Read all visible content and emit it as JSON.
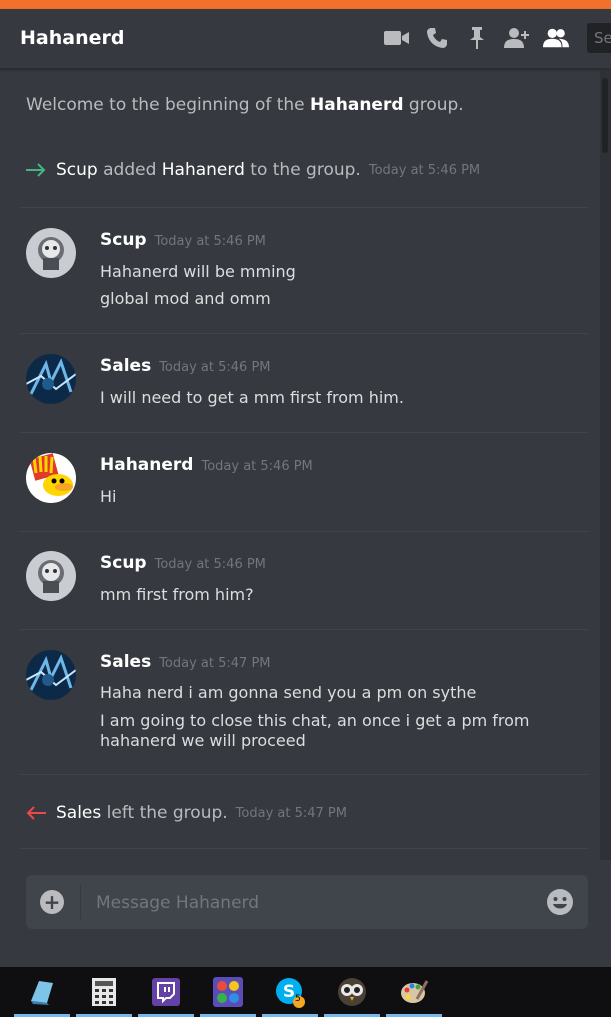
{
  "colors": {
    "accent_orange": "#f36f2c",
    "join_arrow": "#43b581",
    "leave_arrow": "#f04747",
    "bg": "#36393f"
  },
  "header": {
    "title": "Hahanerd",
    "icons": [
      "video-call-icon",
      "voice-call-icon",
      "pin-icon",
      "add-member-icon",
      "members-icon"
    ],
    "search_placeholder": "Search"
  },
  "messages": {
    "welcome_prefix": "Welcome to the beginning of the ",
    "welcome_group": "Hahanerd",
    "welcome_suffix": " group.",
    "system_join": {
      "actor": "Scup",
      "text_mid": " added ",
      "target": "Hahanerd",
      "text_end": " to the group.",
      "timestamp": "Today at 5:46 PM"
    },
    "system_leave": {
      "actor": "Sales",
      "text_end": " left the group.",
      "timestamp": "Today at 5:47 PM"
    },
    "items": [
      {
        "author": "Scup",
        "timestamp": "Today at 5:46 PM",
        "lines": [
          "Hahanerd will be mming",
          "global mod and omm"
        ]
      },
      {
        "author": "Sales",
        "timestamp": "Today at 5:46 PM",
        "lines": [
          "I will need to get a mm first from him."
        ]
      },
      {
        "author": "Hahanerd",
        "timestamp": "Today at 5:46 PM",
        "lines": [
          "Hi"
        ]
      },
      {
        "author": "Scup",
        "timestamp": "Today at 5:46 PM",
        "lines": [
          "mm first from him?"
        ]
      },
      {
        "author": "Sales",
        "timestamp": "Today at 5:47 PM",
        "lines": [
          "Haha nerd i am gonna send you a pm on sythe",
          "I am going to close this chat, an once i get a pm from hahanerd we will proceed"
        ]
      }
    ]
  },
  "composer": {
    "placeholder": "Message Hahanerd"
  },
  "taskbar": {
    "apps": [
      "notes-icon",
      "calculator-icon",
      "twitch-icon",
      "dots-app-icon",
      "skype-icon",
      "owl-app-icon",
      "paint-icon"
    ],
    "skype_badge": "5"
  }
}
